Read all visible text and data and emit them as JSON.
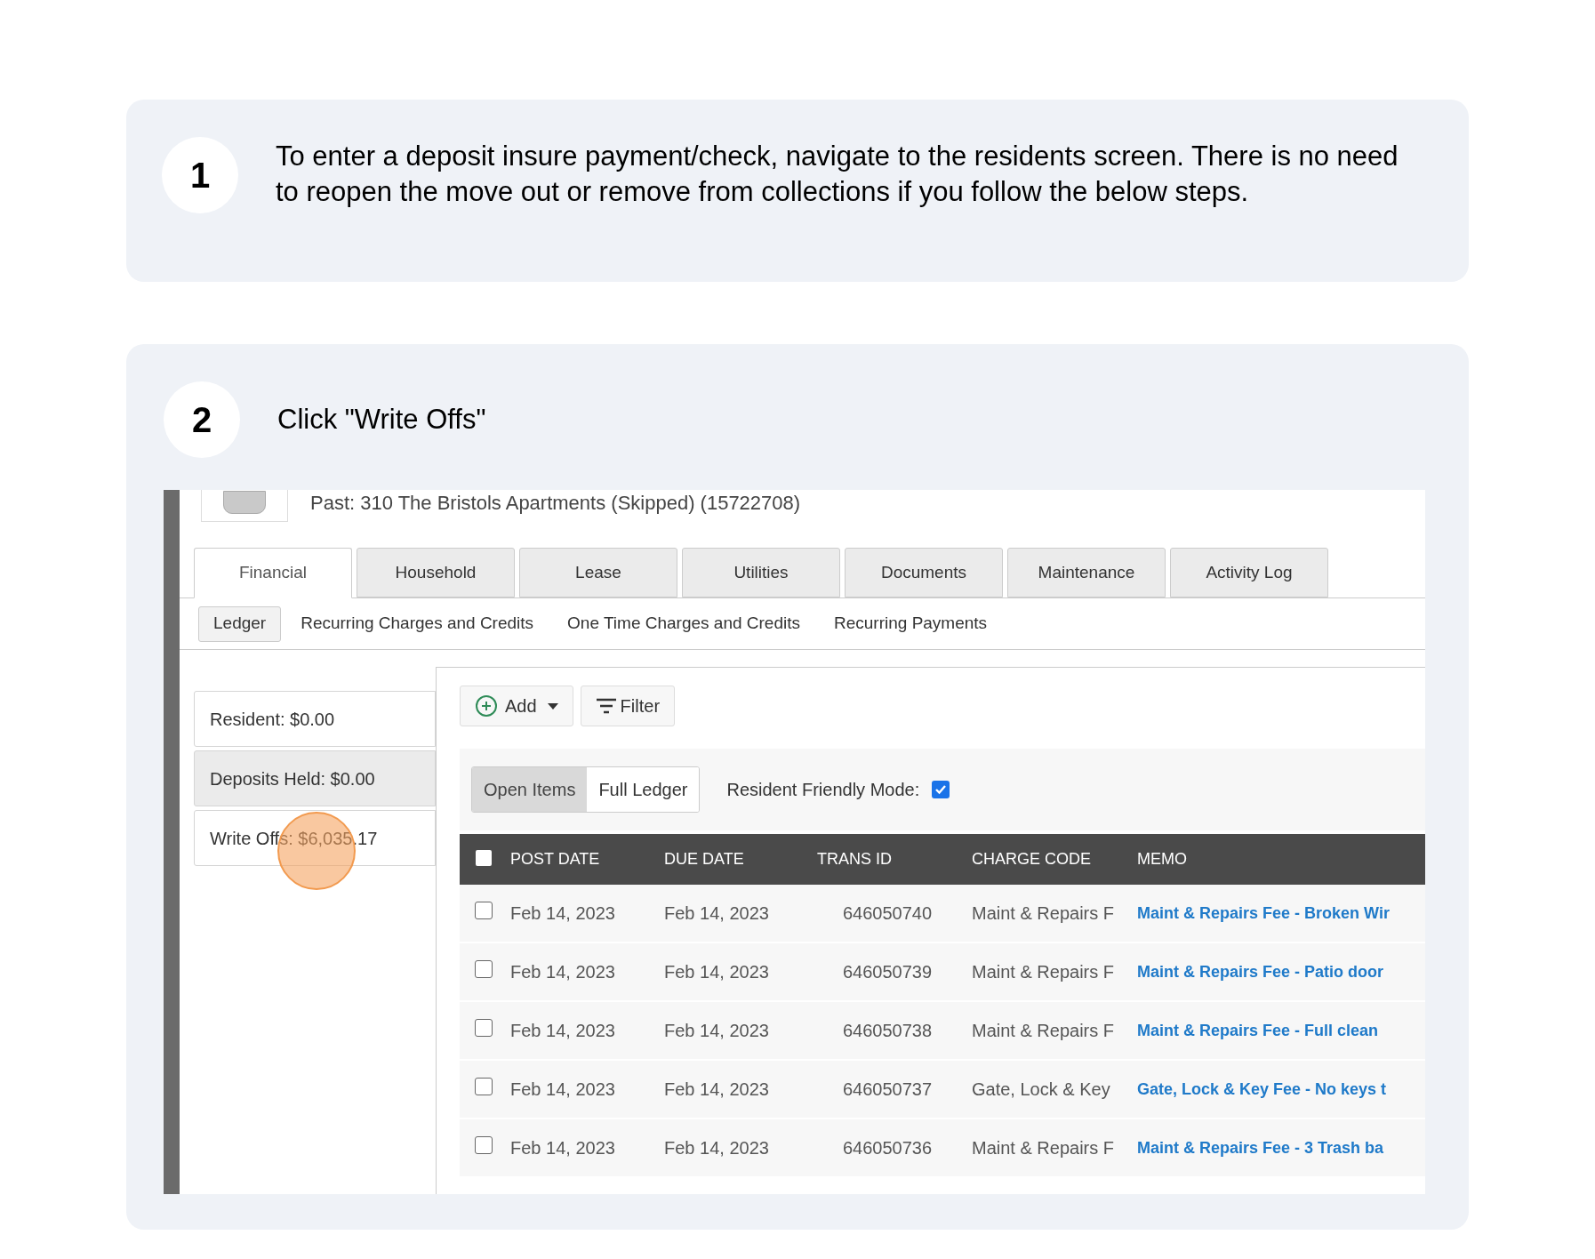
{
  "steps": [
    {
      "number": "1",
      "text": "To enter a deposit insure payment/check, navigate to the residents screen. There is no need to reopen the move out or remove from collections if you follow the below steps."
    },
    {
      "number": "2",
      "text": "Click \"Write Offs\""
    }
  ],
  "screenshot": {
    "header": "Past: 310 The Bristols Apartments (Skipped) (15722708)",
    "tabs": [
      {
        "label": "Financial",
        "selected": true
      },
      {
        "label": "Household",
        "selected": false
      },
      {
        "label": "Lease",
        "selected": false
      },
      {
        "label": "Utilities",
        "selected": false
      },
      {
        "label": "Documents",
        "selected": false
      },
      {
        "label": "Maintenance",
        "selected": false
      },
      {
        "label": "Activity Log",
        "selected": false
      }
    ],
    "subtabs": [
      {
        "label": "Ledger",
        "selected": true
      },
      {
        "label": "Recurring Charges and Credits",
        "selected": false
      },
      {
        "label": "One Time Charges and Credits",
        "selected": false
      },
      {
        "label": "Recurring Payments",
        "selected": false
      }
    ],
    "balances": [
      {
        "label": "Resident: $0.00",
        "selected": false
      },
      {
        "label": "Deposits Held: $0.00",
        "selected": true
      },
      {
        "label": "Write Offs: $6,035.17",
        "selected": false
      }
    ],
    "toolbar": {
      "add": "Add",
      "filter": "Filter"
    },
    "view_toggle": [
      {
        "label": "Open Items",
        "selected": true
      },
      {
        "label": "Full Ledger",
        "selected": false
      }
    ],
    "resident_friendly": {
      "label": "Resident Friendly Mode:",
      "checked": true
    },
    "table": {
      "select_all_checked": false,
      "columns": [
        "POST DATE",
        "DUE DATE",
        "TRANS ID",
        "CHARGE CODE",
        "MEMO"
      ],
      "rows": [
        {
          "checked": false,
          "cells": [
            "Feb 14, 2023",
            "Feb 14, 2023",
            "646050740",
            "Maint & Repairs F",
            "Maint & Repairs Fee - Broken Wir"
          ]
        },
        {
          "checked": false,
          "cells": [
            "Feb 14, 2023",
            "Feb 14, 2023",
            "646050739",
            "Maint & Repairs F",
            "Maint & Repairs Fee - Patio door"
          ]
        },
        {
          "checked": false,
          "cells": [
            "Feb 14, 2023",
            "Feb 14, 2023",
            "646050738",
            "Maint & Repairs F",
            "Maint & Repairs Fee - Full clean"
          ]
        },
        {
          "checked": false,
          "cells": [
            "Feb 14, 2023",
            "Feb 14, 2023",
            "646050737",
            "Gate, Lock & Key",
            "Gate, Lock & Key Fee - No keys t"
          ]
        },
        {
          "checked": false,
          "cells": [
            "Feb 14, 2023",
            "Feb 14, 2023",
            "646050736",
            "Maint & Repairs F",
            "Maint & Repairs Fee - 3 Trash ba"
          ]
        }
      ]
    }
  }
}
